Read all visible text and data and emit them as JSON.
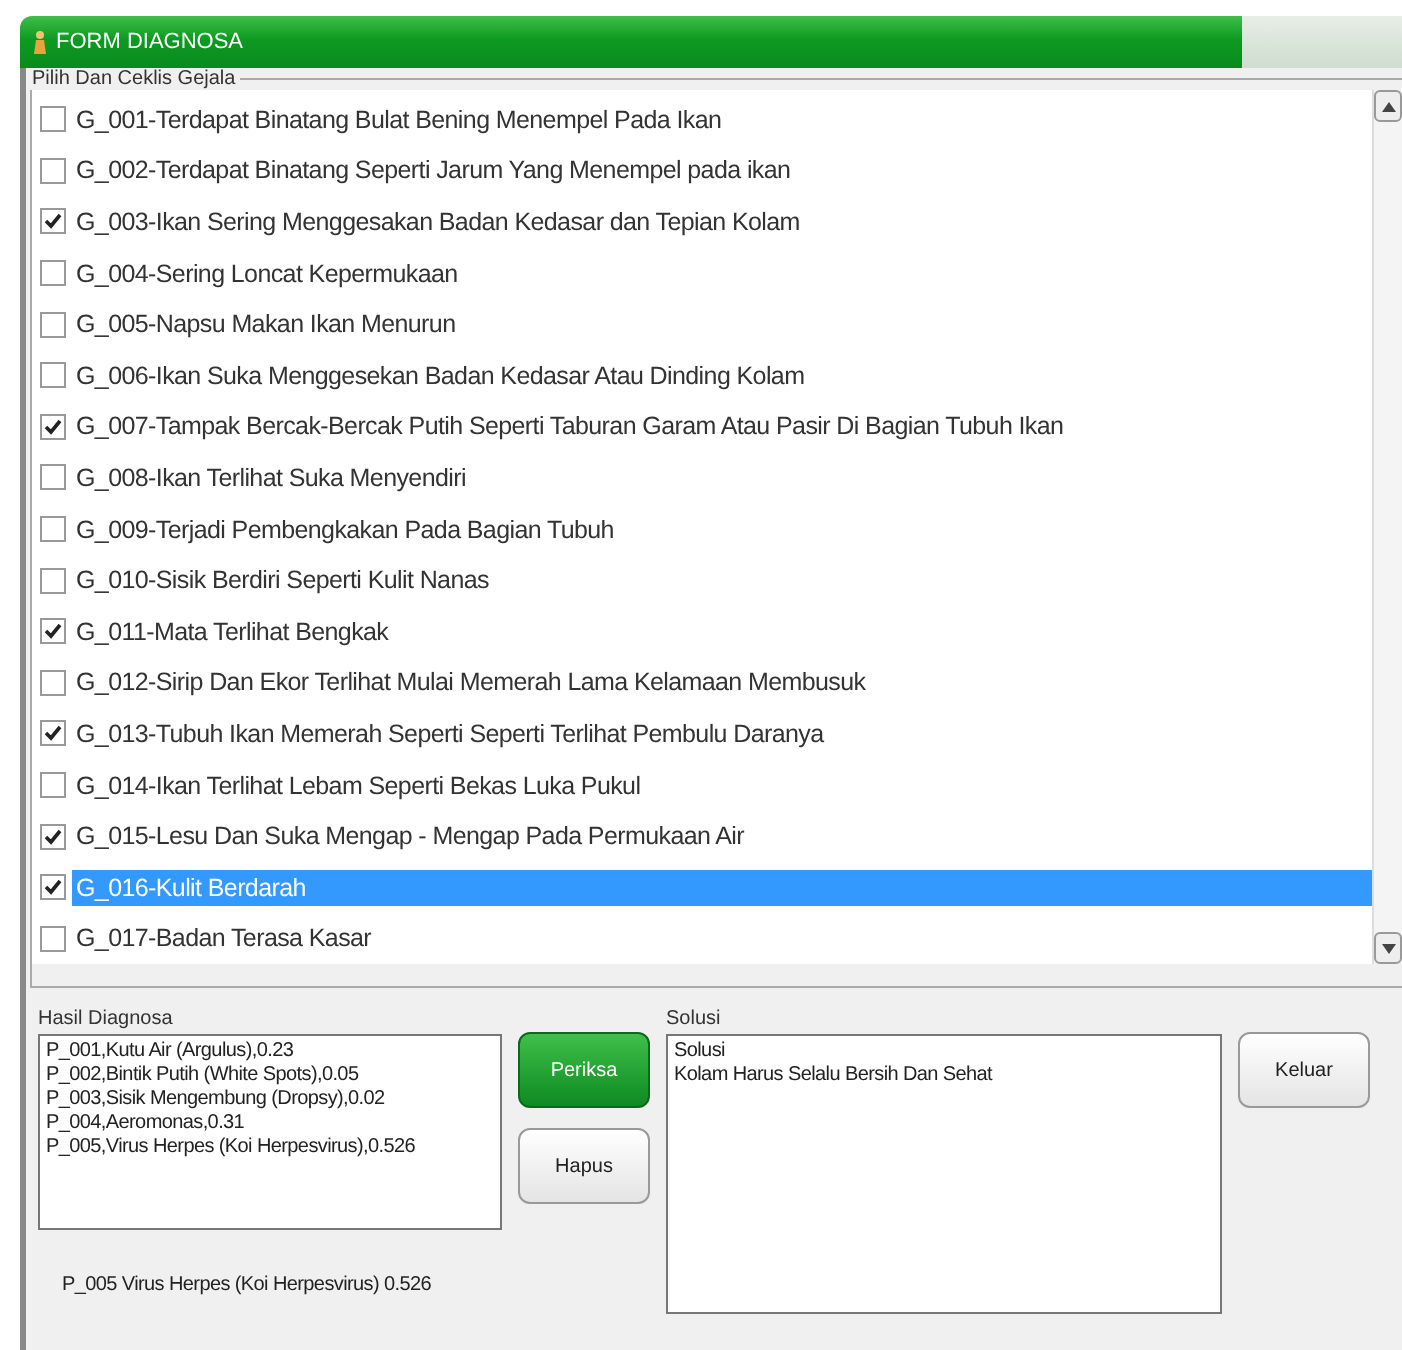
{
  "window": {
    "title": "FORM DIAGNOSA"
  },
  "symptoms": {
    "legend": "Pilih Dan Ceklis Gejala",
    "items": [
      {
        "label": "G_001-Terdapat Binatang Bulat Bening Menempel Pada Ikan",
        "checked": false,
        "selected": false
      },
      {
        "label": "G_002-Terdapat Binatang Seperti Jarum Yang Menempel pada ikan",
        "checked": false,
        "selected": false
      },
      {
        "label": "G_003-Ikan Sering Menggesakan Badan Kedasar dan Tepian Kolam",
        "checked": true,
        "selected": false
      },
      {
        "label": "G_004-Sering Loncat Kepermukaan",
        "checked": false,
        "selected": false
      },
      {
        "label": "G_005-Napsu Makan Ikan Menurun",
        "checked": false,
        "selected": false
      },
      {
        "label": "G_006-Ikan Suka Menggesekan Badan Kedasar Atau Dinding Kolam",
        "checked": false,
        "selected": false
      },
      {
        "label": "G_007-Tampak Bercak-Bercak Putih Seperti Taburan Garam Atau Pasir Di Bagian Tubuh Ikan",
        "checked": true,
        "selected": false
      },
      {
        "label": "G_008-Ikan Terlihat Suka Menyendiri",
        "checked": false,
        "selected": false
      },
      {
        "label": "G_009-Terjadi Pembengkakan Pada Bagian Tubuh",
        "checked": false,
        "selected": false
      },
      {
        "label": "G_010-Sisik Berdiri Seperti Kulit Nanas",
        "checked": false,
        "selected": false
      },
      {
        "label": "G_011-Mata Terlihat Bengkak",
        "checked": true,
        "selected": false
      },
      {
        "label": "G_012-Sirip Dan Ekor Terlihat Mulai Memerah Lama Kelamaan Membusuk",
        "checked": false,
        "selected": false
      },
      {
        "label": "G_013-Tubuh Ikan Memerah Seperti Seperti Terlihat Pembulu Daranya",
        "checked": true,
        "selected": false
      },
      {
        "label": "G_014-Ikan Terlihat Lebam Seperti Bekas Luka Pukul",
        "checked": false,
        "selected": false
      },
      {
        "label": "G_015-Lesu Dan Suka Mengap  - Mengap Pada Permukaan Air",
        "checked": true,
        "selected": false
      },
      {
        "label": "G_016-Kulit Berdarah",
        "checked": true,
        "selected": true
      },
      {
        "label": "G_017-Badan Terasa Kasar",
        "checked": false,
        "selected": false
      }
    ]
  },
  "results": {
    "label": "Hasil Diagnosa",
    "lines": [
      "P_001,Kutu Air (Argulus),0.23",
      "P_002,Bintik Putih (White Spots),0.05",
      "P_003,Sisik Mengembung (Dropsy),0.02",
      "P_004,Aeromonas,0.31",
      "P_005,Virus Herpes (Koi Herpesvirus),0.526"
    ]
  },
  "buttons": [
    {
      "label": "Periksa",
      "kind": "primary"
    },
    {
      "label": "Hapus",
      "kind": "normal"
    }
  ],
  "solution": {
    "label": "Solusi",
    "lines": [
      "Solusi",
      "Kolam Harus Selalu Bersih Dan Sehat"
    ]
  },
  "exit_button": {
    "label": "Keluar"
  },
  "final_result": "P_005  Virus Herpes (Koi Herpesvirus)  0.526"
}
